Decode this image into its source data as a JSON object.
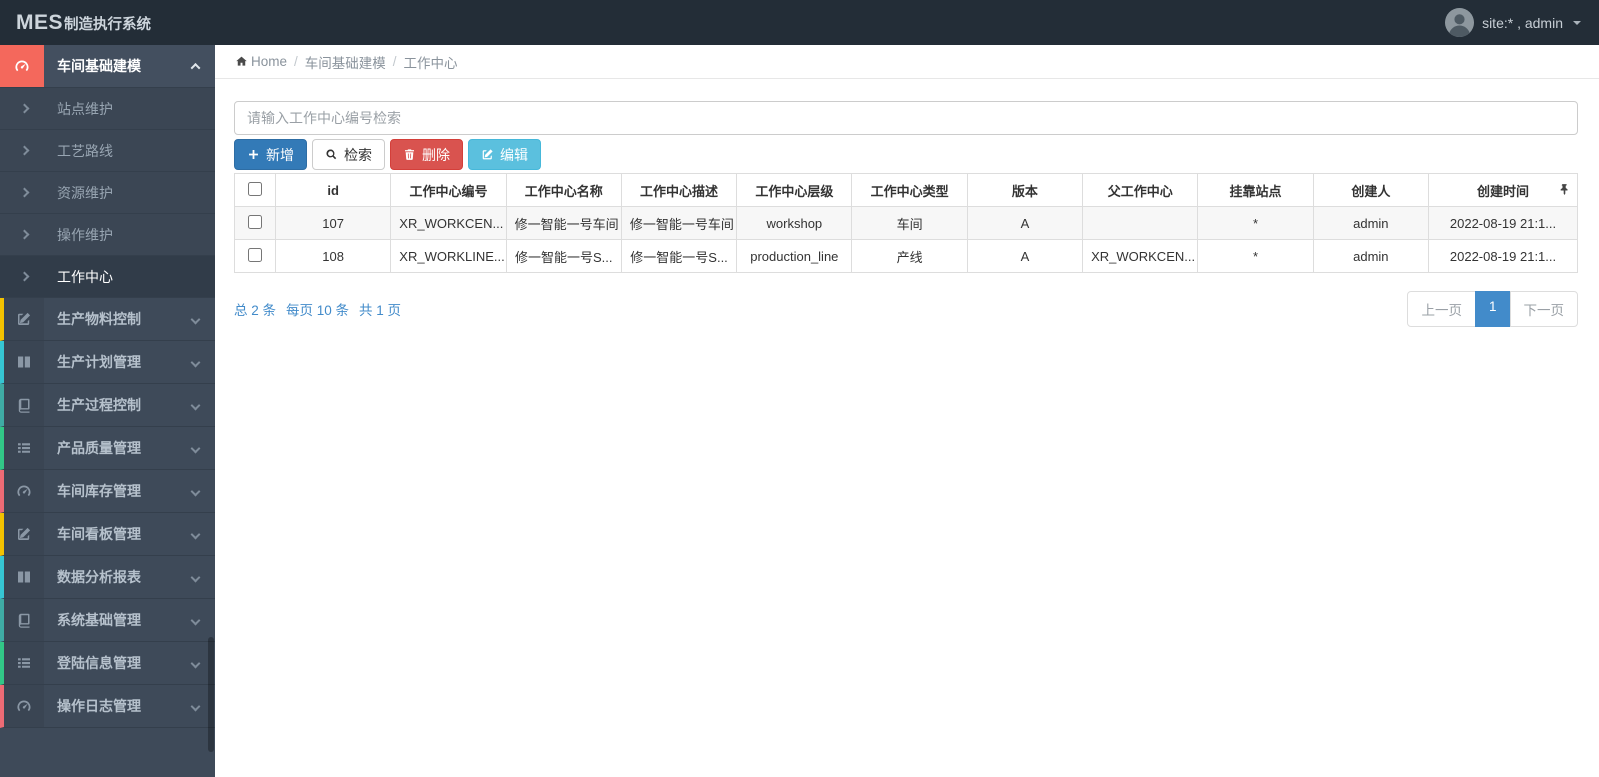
{
  "theme": {
    "topbar_bg": "#232d37",
    "sidebar_bg": "#3e4a59",
    "brand_red": "#f4685c",
    "primary_blue": "#337ab7",
    "danger_red": "#d9534f",
    "info_cyan": "#5bc0de",
    "link_blue": "#428bca",
    "pagination_active": "#428bca"
  },
  "app": {
    "brand_bold": "MES",
    "brand_rest": "制造执行系统"
  },
  "topbar": {
    "user_label": "site:* , admin"
  },
  "sidebar": {
    "parent": {
      "label": "车间基础建模",
      "icon": "gauge-icon"
    },
    "subitems": [
      {
        "label": "站点维护"
      },
      {
        "label": "工艺路线"
      },
      {
        "label": "资源维护"
      },
      {
        "label": "操作维护"
      },
      {
        "label": "工作中心"
      }
    ],
    "sections": [
      {
        "label": "生产物料控制",
        "strip_color": "#f3c200",
        "icon": "pencil-icon"
      },
      {
        "label": "生产计划管理",
        "strip_color": "#36c6d3",
        "icon": "columns-icon"
      },
      {
        "label": "生产过程控制",
        "strip_color": "#3faba4",
        "icon": "book-icon"
      },
      {
        "label": "产品质量管理",
        "strip_color": "#32c787",
        "icon": "list-icon"
      },
      {
        "label": "车间库存管理",
        "strip_color": "#ed6b75",
        "icon": "gauge-icon"
      },
      {
        "label": "车间看板管理",
        "strip_color": "#f3c200",
        "icon": "pencil-icon"
      },
      {
        "label": "数据分析报表",
        "strip_color": "#36c6d3",
        "icon": "columns-icon"
      },
      {
        "label": "系统基础管理",
        "strip_color": "#3faba4",
        "icon": "book-icon"
      },
      {
        "label": "登陆信息管理",
        "strip_color": "#32c787",
        "icon": "list-icon"
      },
      {
        "label": "操作日志管理",
        "strip_color": "#ed6b75",
        "icon": "gauge-icon"
      }
    ]
  },
  "breadcrumb": {
    "home_label": "Home",
    "separator": "/",
    "crumbs": [
      "车间基础建模",
      "工作中心"
    ]
  },
  "search": {
    "placeholder": "请输入工作中心编号检索"
  },
  "toolbar": {
    "buttons": [
      {
        "label": "新增",
        "icon": "plus-icon",
        "bg": "#337ab7"
      },
      {
        "label": "检索",
        "icon": "search-icon",
        "bg": "#ffffff"
      },
      {
        "label": "删除",
        "icon": "trash-icon",
        "bg": "#d9534f"
      },
      {
        "label": "编辑",
        "icon": "edit-icon",
        "bg": "#5bc0de"
      }
    ]
  },
  "table": {
    "columns": [
      "id",
      "工作中心编号",
      "工作中心名称",
      "工作中心描述",
      "工作中心层级",
      "工作中心类型",
      "版本",
      "父工作中心",
      "挂靠站点",
      "创建人",
      "创建时间"
    ],
    "rows": [
      [
        "107",
        "XR_WORKCEN...",
        "修一智能一号车间",
        "修一智能一号车间",
        "workshop",
        "车间",
        "A",
        "",
        "*",
        "admin",
        "2022-08-19 21:1..."
      ],
      [
        "108",
        "XR_WORKLINE...",
        "修一智能一号S...",
        "修一智能一号S...",
        "production_line",
        "产线",
        "A",
        "XR_WORKCEN...",
        "*",
        "admin",
        "2022-08-19 21:1..."
      ]
    ]
  },
  "pagination": {
    "info_total": "总 2 条",
    "info_per_page": "每页 10 条",
    "info_pages": "共 1 页",
    "prev_label": "上一页",
    "current_page": "1",
    "next_label": "下一页"
  }
}
